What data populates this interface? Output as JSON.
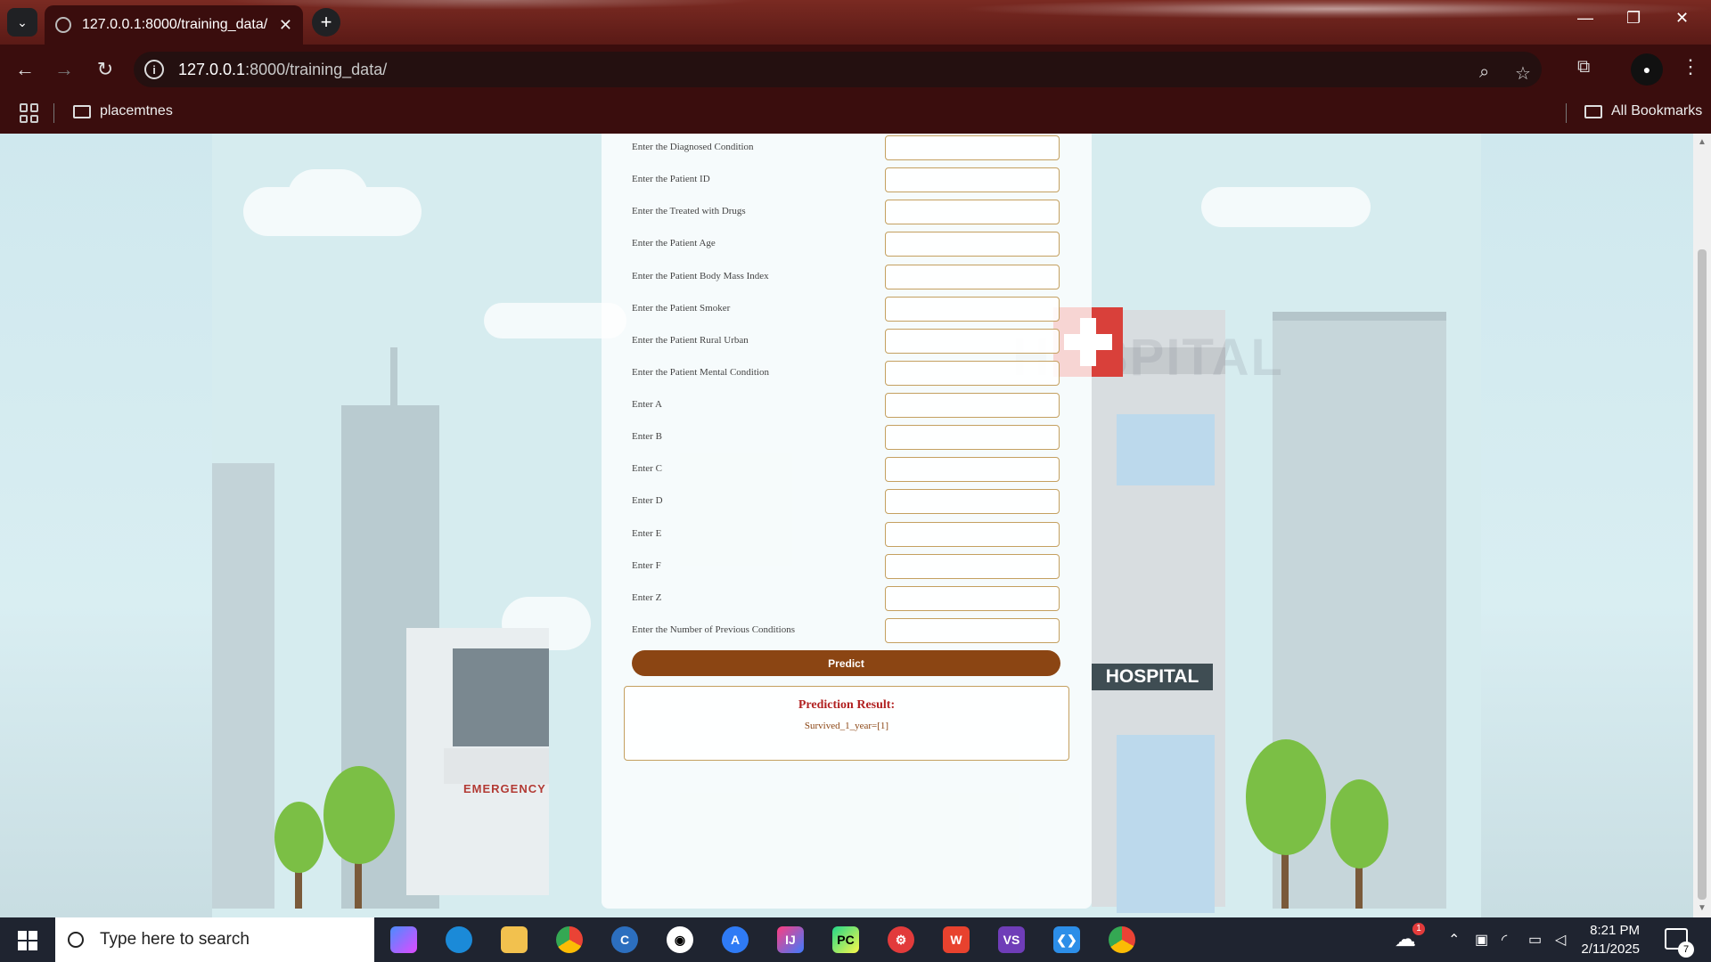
{
  "browser": {
    "tab_title": "127.0.0.1:8000/training_data/",
    "tab_close": "✕",
    "new_tab": "+",
    "url_host": "127.0.0.1",
    "url_path": ":8000/training_data/",
    "bookmarks": [
      "placemtnes"
    ],
    "all_bookmarks": "All Bookmarks"
  },
  "form": {
    "fields": [
      {
        "label": "Enter the Diagnosed Condition",
        "value": ""
      },
      {
        "label": "Enter the Patient ID",
        "value": ""
      },
      {
        "label": "Enter the Treated with Drugs",
        "value": ""
      },
      {
        "label": "Enter the Patient Age",
        "value": ""
      },
      {
        "label": "Enter the Patient Body Mass Index",
        "value": ""
      },
      {
        "label": "Enter the Patient Smoker",
        "value": ""
      },
      {
        "label": "Enter the Patient Rural Urban",
        "value": ""
      },
      {
        "label": "Enter the Patient Mental Condition",
        "value": ""
      },
      {
        "label": "Enter A",
        "value": ""
      },
      {
        "label": "Enter B",
        "value": ""
      },
      {
        "label": "Enter C",
        "value": ""
      },
      {
        "label": "Enter D",
        "value": ""
      },
      {
        "label": "Enter E",
        "value": ""
      },
      {
        "label": "Enter F",
        "value": ""
      },
      {
        "label": "Enter Z",
        "value": ""
      },
      {
        "label": "Enter the Number of Previous Conditions",
        "value": ""
      }
    ],
    "predict_label": "Predict"
  },
  "result": {
    "title": "Prediction Result:",
    "value": "Survived_1_year=[1]"
  },
  "background": {
    "sign_text": "HOSPITAL",
    "emergency_text": "EMERGENCY",
    "faded_text": "HOSPITAL"
  },
  "taskbar": {
    "search_placeholder": "Type here to search",
    "time": "8:21 PM",
    "date": "2/11/2025",
    "notification_count": "7",
    "weather_badge": "1",
    "apps": [
      "copilot",
      "edge",
      "file-explorer",
      "chrome",
      "ccleaner",
      "github",
      "app-store",
      "intellij",
      "pycharm",
      "app-red",
      "wps",
      "visual-studio",
      "vscode",
      "chrome-active"
    ]
  },
  "colors": {
    "accent_brown": "#8b4513",
    "result_title": "#b22222",
    "input_border": "#c4a060"
  }
}
